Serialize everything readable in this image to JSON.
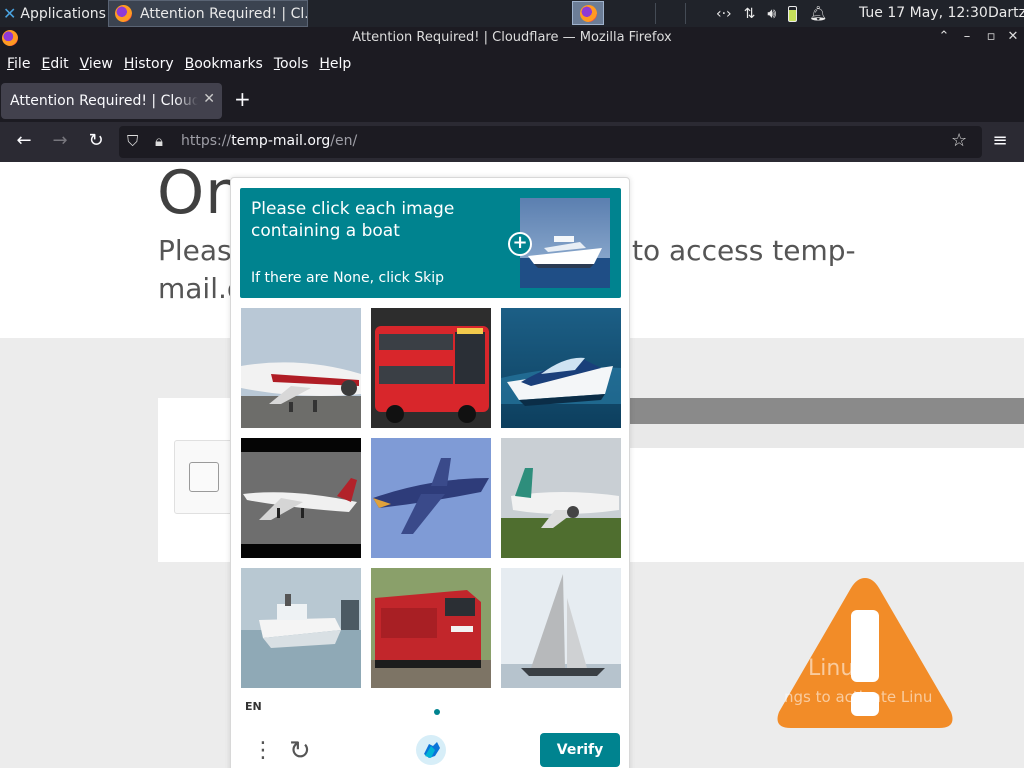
{
  "panel": {
    "applications_label": "Applications",
    "task_title": "Attention Required! | Cl...",
    "clock": "Tue 17 May, 12:30",
    "user": "Dartz"
  },
  "window": {
    "title": "Attention Required! | Cloudflare — Mozilla Firefox"
  },
  "menubar": {
    "items": [
      "File",
      "Edit",
      "View",
      "History",
      "Bookmarks",
      "Tools",
      "Help"
    ]
  },
  "tabs": [
    {
      "title": "Attention Required! | Cloudflare"
    }
  ],
  "url": {
    "prefix": "https://",
    "domain": "temp-mail.org",
    "path": "/en/"
  },
  "page": {
    "heading_fragment": "On",
    "line1_left": "Pleas",
    "line1_right": "to access temp-",
    "line2": "mail.o",
    "watermark_title": "Linu",
    "watermark_sub": "ngs to activate Linu"
  },
  "captcha": {
    "prompt_line1": "Please click each image containing a boat",
    "prompt_line2": "If there are None, click Skip",
    "language": "EN",
    "verify_label": "Verify",
    "accent_color": "#00838f",
    "tiles": [
      {
        "subject": "airplane",
        "selected": false
      },
      {
        "subject": "bus",
        "selected": false
      },
      {
        "subject": "boat",
        "selected": false
      },
      {
        "subject": "airplane",
        "selected": false
      },
      {
        "subject": "airplane",
        "selected": false
      },
      {
        "subject": "airplane",
        "selected": false
      },
      {
        "subject": "boat",
        "selected": false
      },
      {
        "subject": "train",
        "selected": false
      },
      {
        "subject": "sailboat",
        "selected": false
      }
    ]
  }
}
